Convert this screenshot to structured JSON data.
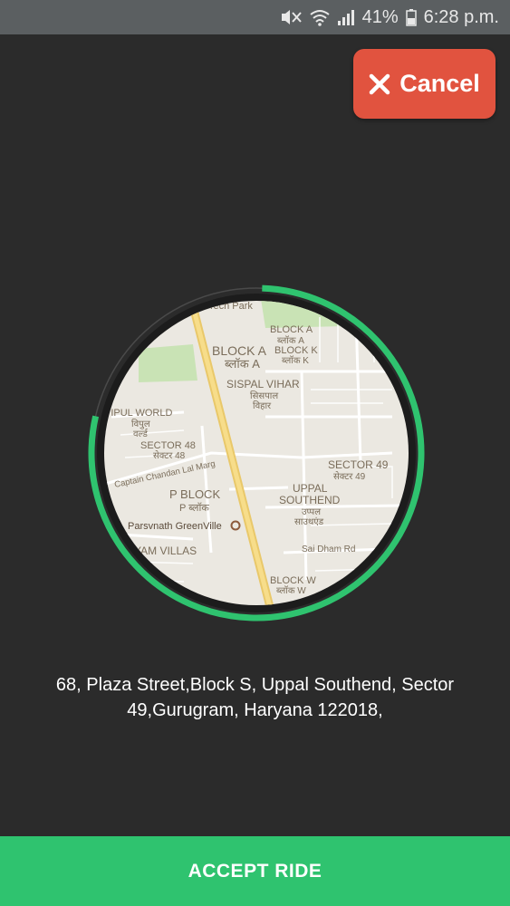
{
  "status_bar": {
    "battery_percent": "41%",
    "time": "6:28 p.m.",
    "icons": [
      "mute-icon",
      "wifi-icon",
      "signal-icon",
      "battery-icon"
    ]
  },
  "cancel": {
    "label": "Cancel",
    "icon": "close-icon",
    "color": "#e1533f"
  },
  "timer": {
    "progress": 0.78,
    "color": "#2fc36f"
  },
  "map": {
    "labels": [
      "Tech Park",
      "BLOCK A",
      "ब्लॉक A",
      "BLOCK A",
      "ब्लॉक A",
      "BLOCK K",
      "ब्लॉक K",
      "SISPAL VIHAR",
      "सिसपाल",
      "विहार",
      "VIPUL WORLD",
      "विपुल",
      "वर्ल्ड",
      "SECTOR 48",
      "सेक्टर 48",
      "Captain Chandan Lal Marg",
      "SECTOR 49",
      "सेक्टर 49",
      "P BLOCK",
      "P ब्लॉक",
      "UPPAL",
      "SOUTHEND",
      "उप्पल",
      "साउथएंड",
      "Parsvnath GreenVille",
      "YAM VILLAS",
      "Sai Dham Rd",
      "BLOCK W",
      "ब्लॉक W"
    ]
  },
  "address": "68, Plaza Street,Block S, Uppal Southend, Sector 49,Gurugram, Haryana 122018,",
  "accept": {
    "label": "ACCEPT RIDE",
    "color": "#2fc36f"
  }
}
